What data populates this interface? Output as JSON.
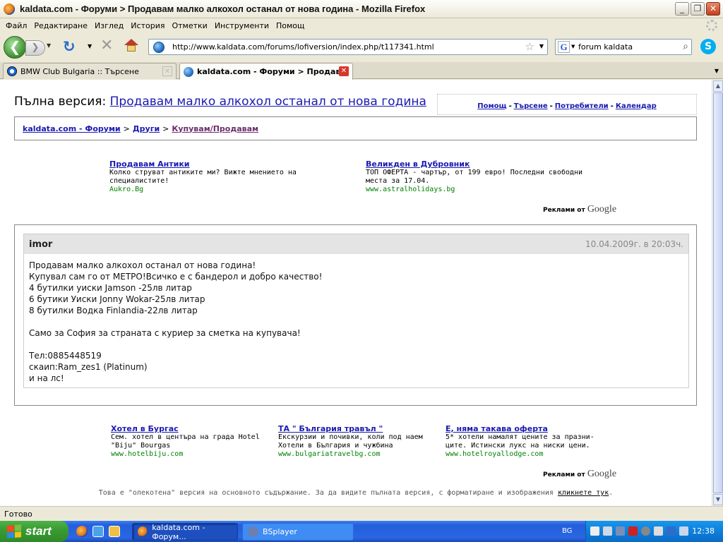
{
  "window": {
    "title": "kaldata.com - Форуми > Продавам малко алкохол останал от нова година - Mozilla Firefox",
    "buttons": {
      "minimize": "_",
      "maximize": "❐",
      "close": "✕"
    }
  },
  "menu": [
    "Файл",
    "Редактиране",
    "Изглед",
    "История",
    "Отметки",
    "Инструменти",
    "Помощ"
  ],
  "nav": {
    "url": "http://www.kaldata.com/forums/lofiversion/index.php/t117341.html",
    "search_value": "forum kaldata",
    "search_engine_letter": "G",
    "back_glyph": "❮",
    "forward_glyph": "❯",
    "reload_glyph": "↻",
    "stop_glyph": "✕",
    "star_glyph": "☆",
    "search_glyph": "⌕",
    "skype_letter": "S"
  },
  "tabs": [
    {
      "label": "BMW Club Bulgaria :: Търсене",
      "active": false
    },
    {
      "label": "kaldata.com - Форуми > Продав...",
      "active": true
    }
  ],
  "page": {
    "full_version_label": "Пълна версия:",
    "topic_title": "Продавам малко алкохол останал от нова година",
    "top_links": [
      "Помощ",
      "Търсене",
      "Потребители",
      "Календар"
    ],
    "top_links_sep": "-",
    "breadcrumb": [
      "kaldata.com - Форуми",
      "Други",
      "Купувам/Продавам"
    ],
    "breadcrumb_sep": ">",
    "ads_top": [
      {
        "title": "Продавам Антики",
        "desc": "Колко струват антиките ми? Вижте мнението на специалистите!",
        "url": "Aukro.Bg"
      },
      {
        "title": "Великден в Дубровник",
        "desc": "ТОП ОФЕРТА - чартър, от 199 евро! Последни свободни места за 17.04.",
        "url": "www.astralholidays.bg"
      }
    ],
    "ads_by_label": "Реклами от",
    "google_label": "Google",
    "post": {
      "author": "imor",
      "date": "10.04.2009г. в 20:03ч.",
      "lines": [
        "Продавам малко алкохол останал от нова година!",
        "Купувал сам го от МЕТРО!Всичко е с бандерол и добро качество!",
        "4 бутилки уиски Jamson -25лв литар",
        "6 бутики Уиски Jonny Wokar-25лв литар",
        "8 бутилки Водка Finlandia-22лв литар",
        "",
        "Само за София за страната с куриер за сметка на купувача!",
        "",
        "Тел:0885448519",
        "скаип:Ram_zes1 (Platinum)",
        "и на лс!"
      ]
    },
    "ads_bottom": [
      {
        "title": "Хотел в Бургас",
        "desc": "Сем. хотел в центъра на града Hotel \"Biju\" Bourgas",
        "url": "www.hotelbiju.com"
      },
      {
        "title": "ТА \" България травъл \"",
        "desc": "Екскурзии и почивки, коли под наем Хотели в България и чужбина",
        "url": "www.bulgariatravelbg.com"
      },
      {
        "title": "Е, няма такава оферта",
        "desc": "5* хотели намалят цените за празни-ците. Истински лукс на ниски цени.",
        "url": "www.hotelroyallodge.com"
      }
    ],
    "lofi_note": "Това е \"олекотена\" версия на основното съдържание. За да видите пълната версия, с форматиране и изображения",
    "lofi_link": "кликнете тук",
    "lofi_end": "."
  },
  "status": "Готово",
  "taskbar": {
    "start_label": "start",
    "tasks": [
      {
        "label": "kaldata.com - Форум...",
        "active": true
      },
      {
        "label": "BSplayer",
        "active": false
      }
    ],
    "language": "BG",
    "clock": "12:38"
  }
}
